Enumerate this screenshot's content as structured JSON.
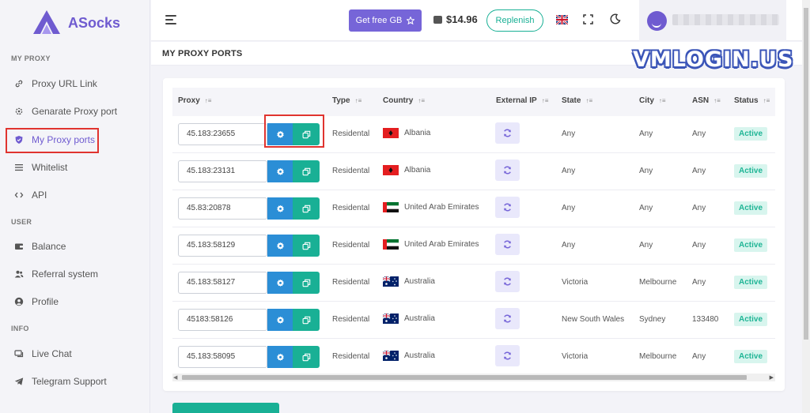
{
  "brand": {
    "name": "ASocks"
  },
  "sidebar": {
    "sections": [
      {
        "title": "MY PROXY",
        "items": [
          {
            "label": "Proxy URL Link",
            "icon": "link-icon"
          },
          {
            "label": "Genarate Proxy port",
            "icon": "gear-icon"
          },
          {
            "label": "My Proxy ports",
            "icon": "shield-icon",
            "active": true
          },
          {
            "label": "Whitelist",
            "icon": "list-icon"
          },
          {
            "label": "API",
            "icon": "code-icon"
          }
        ]
      },
      {
        "title": "USER",
        "items": [
          {
            "label": "Balance",
            "icon": "wallet-icon"
          },
          {
            "label": "Referral system",
            "icon": "users-icon"
          },
          {
            "label": "Profile",
            "icon": "profile-icon"
          }
        ]
      },
      {
        "title": "INFO",
        "items": [
          {
            "label": "Live Chat",
            "icon": "chat-icon"
          },
          {
            "label": "Telegram Support",
            "icon": "telegram-icon"
          }
        ]
      }
    ]
  },
  "topbar": {
    "get_free_label": "Get free GB",
    "balance": "$14.96",
    "replenish_label": "Replenish",
    "language": "UK"
  },
  "page": {
    "title": "MY PROXY PORTS"
  },
  "watermark": "VMLOGIN.US",
  "table": {
    "columns": [
      "Proxy",
      "Type",
      "Country",
      "External IP",
      "State",
      "City",
      "ASN",
      "Status"
    ],
    "rows": [
      {
        "proxy": "45.183:23655",
        "type": "Residental",
        "country": "Albania",
        "flag": "albania",
        "state": "Any",
        "city": "Any",
        "asn": "Any",
        "status": "Active"
      },
      {
        "proxy": "45.183:23131",
        "type": "Residental",
        "country": "Albania",
        "flag": "albania",
        "state": "Any",
        "city": "Any",
        "asn": "Any",
        "status": "Active"
      },
      {
        "proxy": "45.83:20878",
        "type": "Residental",
        "country": "United Arab Emirates",
        "flag": "uae",
        "state": "Any",
        "city": "Any",
        "asn": "Any",
        "status": "Active"
      },
      {
        "proxy": "45.183:58129",
        "type": "Residental",
        "country": "United Arab Emirates",
        "flag": "uae",
        "state": "Any",
        "city": "Any",
        "asn": "Any",
        "status": "Active"
      },
      {
        "proxy": "45.183:58127",
        "type": "Residental",
        "country": "Australia",
        "flag": "australia",
        "state": "Victoria",
        "city": "Melbourne",
        "asn": "Any",
        "status": "Active"
      },
      {
        "proxy": "45183:58126",
        "type": "Residental",
        "country": "Australia",
        "flag": "australia",
        "state": "New South Wales",
        "city": "Sydney",
        "asn": "133480",
        "status": "Active"
      },
      {
        "proxy": "45.183:58095",
        "type": "Residental",
        "country": "Australia",
        "flag": "australia",
        "state": "Victoria",
        "city": "Melbourne",
        "asn": "Any",
        "status": "Active"
      }
    ]
  },
  "colors": {
    "accent": "#7665d8",
    "teal": "#19b095",
    "blue": "#2b8ed6",
    "highlight": "#e0342f"
  }
}
